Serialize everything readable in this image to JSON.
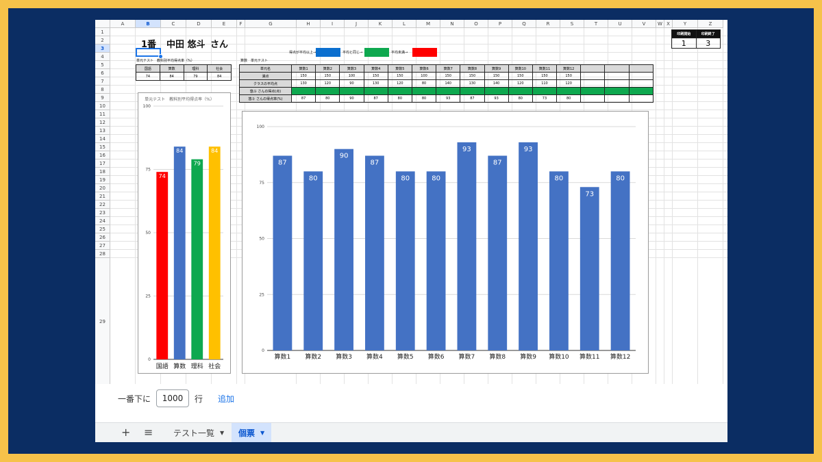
{
  "columns": [
    "A",
    "B",
    "C",
    "D",
    "E",
    "F",
    "G",
    "H",
    "I",
    "J",
    "K",
    "L",
    "M",
    "N",
    "O",
    "P",
    "Q",
    "R",
    "S",
    "T",
    "U",
    "V",
    "W",
    "X",
    "Y",
    "Z"
  ],
  "rows": [
    "1",
    "2",
    "3",
    "4",
    "5",
    "6",
    "7",
    "8",
    "9",
    "10",
    "11",
    "12",
    "13",
    "14",
    "15",
    "16",
    "17",
    "18",
    "19",
    "20",
    "21",
    "22",
    "23",
    "24",
    "25",
    "26",
    "27",
    "28",
    "29"
  ],
  "selected": {
    "column": "B",
    "row": "3"
  },
  "header": {
    "student_no": "1番",
    "student_name": "中田 悠斗",
    "honorific": "さん"
  },
  "legend": {
    "above": "得点が平均以上→",
    "above_color": "#0b6fcf",
    "equal": "平均と同じ→",
    "equal_color": "#0ea84f",
    "below": "平均未満→",
    "below_color": "#ff0000"
  },
  "print": {
    "start_label": "印刷開始",
    "end_label": "印刷終了",
    "start_value": "1",
    "end_value": "3"
  },
  "subject_table": {
    "title": "単元テスト　教科別平均得点率（%）",
    "headers": [
      "国語",
      "算数",
      "理科",
      "社会"
    ],
    "values": [
      "74",
      "84",
      "79",
      "84"
    ]
  },
  "unit_table": {
    "title": "算数　単元テスト",
    "row_labels": [
      "単元名",
      "満点",
      "クラスの平均点",
      "悠斗 さんの得点(点)",
      "悠斗 さんの得点率(%)"
    ],
    "units": [
      "算数1",
      "算数2",
      "算数3",
      "算数4",
      "算数5",
      "算数6",
      "算数7",
      "算数8",
      "算数9",
      "算数10",
      "算数11",
      "算数12"
    ],
    "full_marks": [
      "150",
      "150",
      "100",
      "150",
      "150",
      "100",
      "150",
      "150",
      "150",
      "150",
      "150",
      "150"
    ],
    "class_avg": [
      "130",
      "120",
      "90",
      "130",
      "120",
      "80",
      "140",
      "130",
      "140",
      "120",
      "110",
      "120"
    ],
    "rates": [
      "87",
      "80",
      "90",
      "87",
      "80",
      "80",
      "93",
      "87",
      "93",
      "80",
      "73",
      "80"
    ]
  },
  "chart_data": [
    {
      "type": "bar",
      "title": "単元テスト　教科別平均得点率（%）",
      "categories": [
        "国語",
        "算数",
        "理科",
        "社会"
      ],
      "values": [
        74,
        84,
        79,
        84
      ],
      "colors": [
        "#ff0000",
        "#4472c4",
        "#0ea84f",
        "#ffc000"
      ],
      "yticks": [
        0,
        25,
        50,
        75,
        100
      ],
      "ylim": [
        0,
        100
      ],
      "grid": true
    },
    {
      "type": "bar",
      "categories": [
        "算数1",
        "算数2",
        "算数3",
        "算数4",
        "算数5",
        "算数6",
        "算数7",
        "算数8",
        "算数9",
        "算数10",
        "算数11",
        "算数12"
      ],
      "values": [
        87,
        80,
        90,
        87,
        80,
        80,
        93,
        87,
        93,
        80,
        73,
        80
      ],
      "colors": [
        "#4472c4"
      ],
      "yticks": [
        0,
        25,
        50,
        75,
        100
      ],
      "ylim": [
        0,
        100
      ],
      "grid": true
    }
  ],
  "bottom": {
    "prefix": "一番下に",
    "row_count": "1000",
    "suffix": "行",
    "add_label": "追加"
  },
  "tabs": [
    {
      "label": "テスト一覧"
    },
    {
      "label": "個票"
    }
  ]
}
